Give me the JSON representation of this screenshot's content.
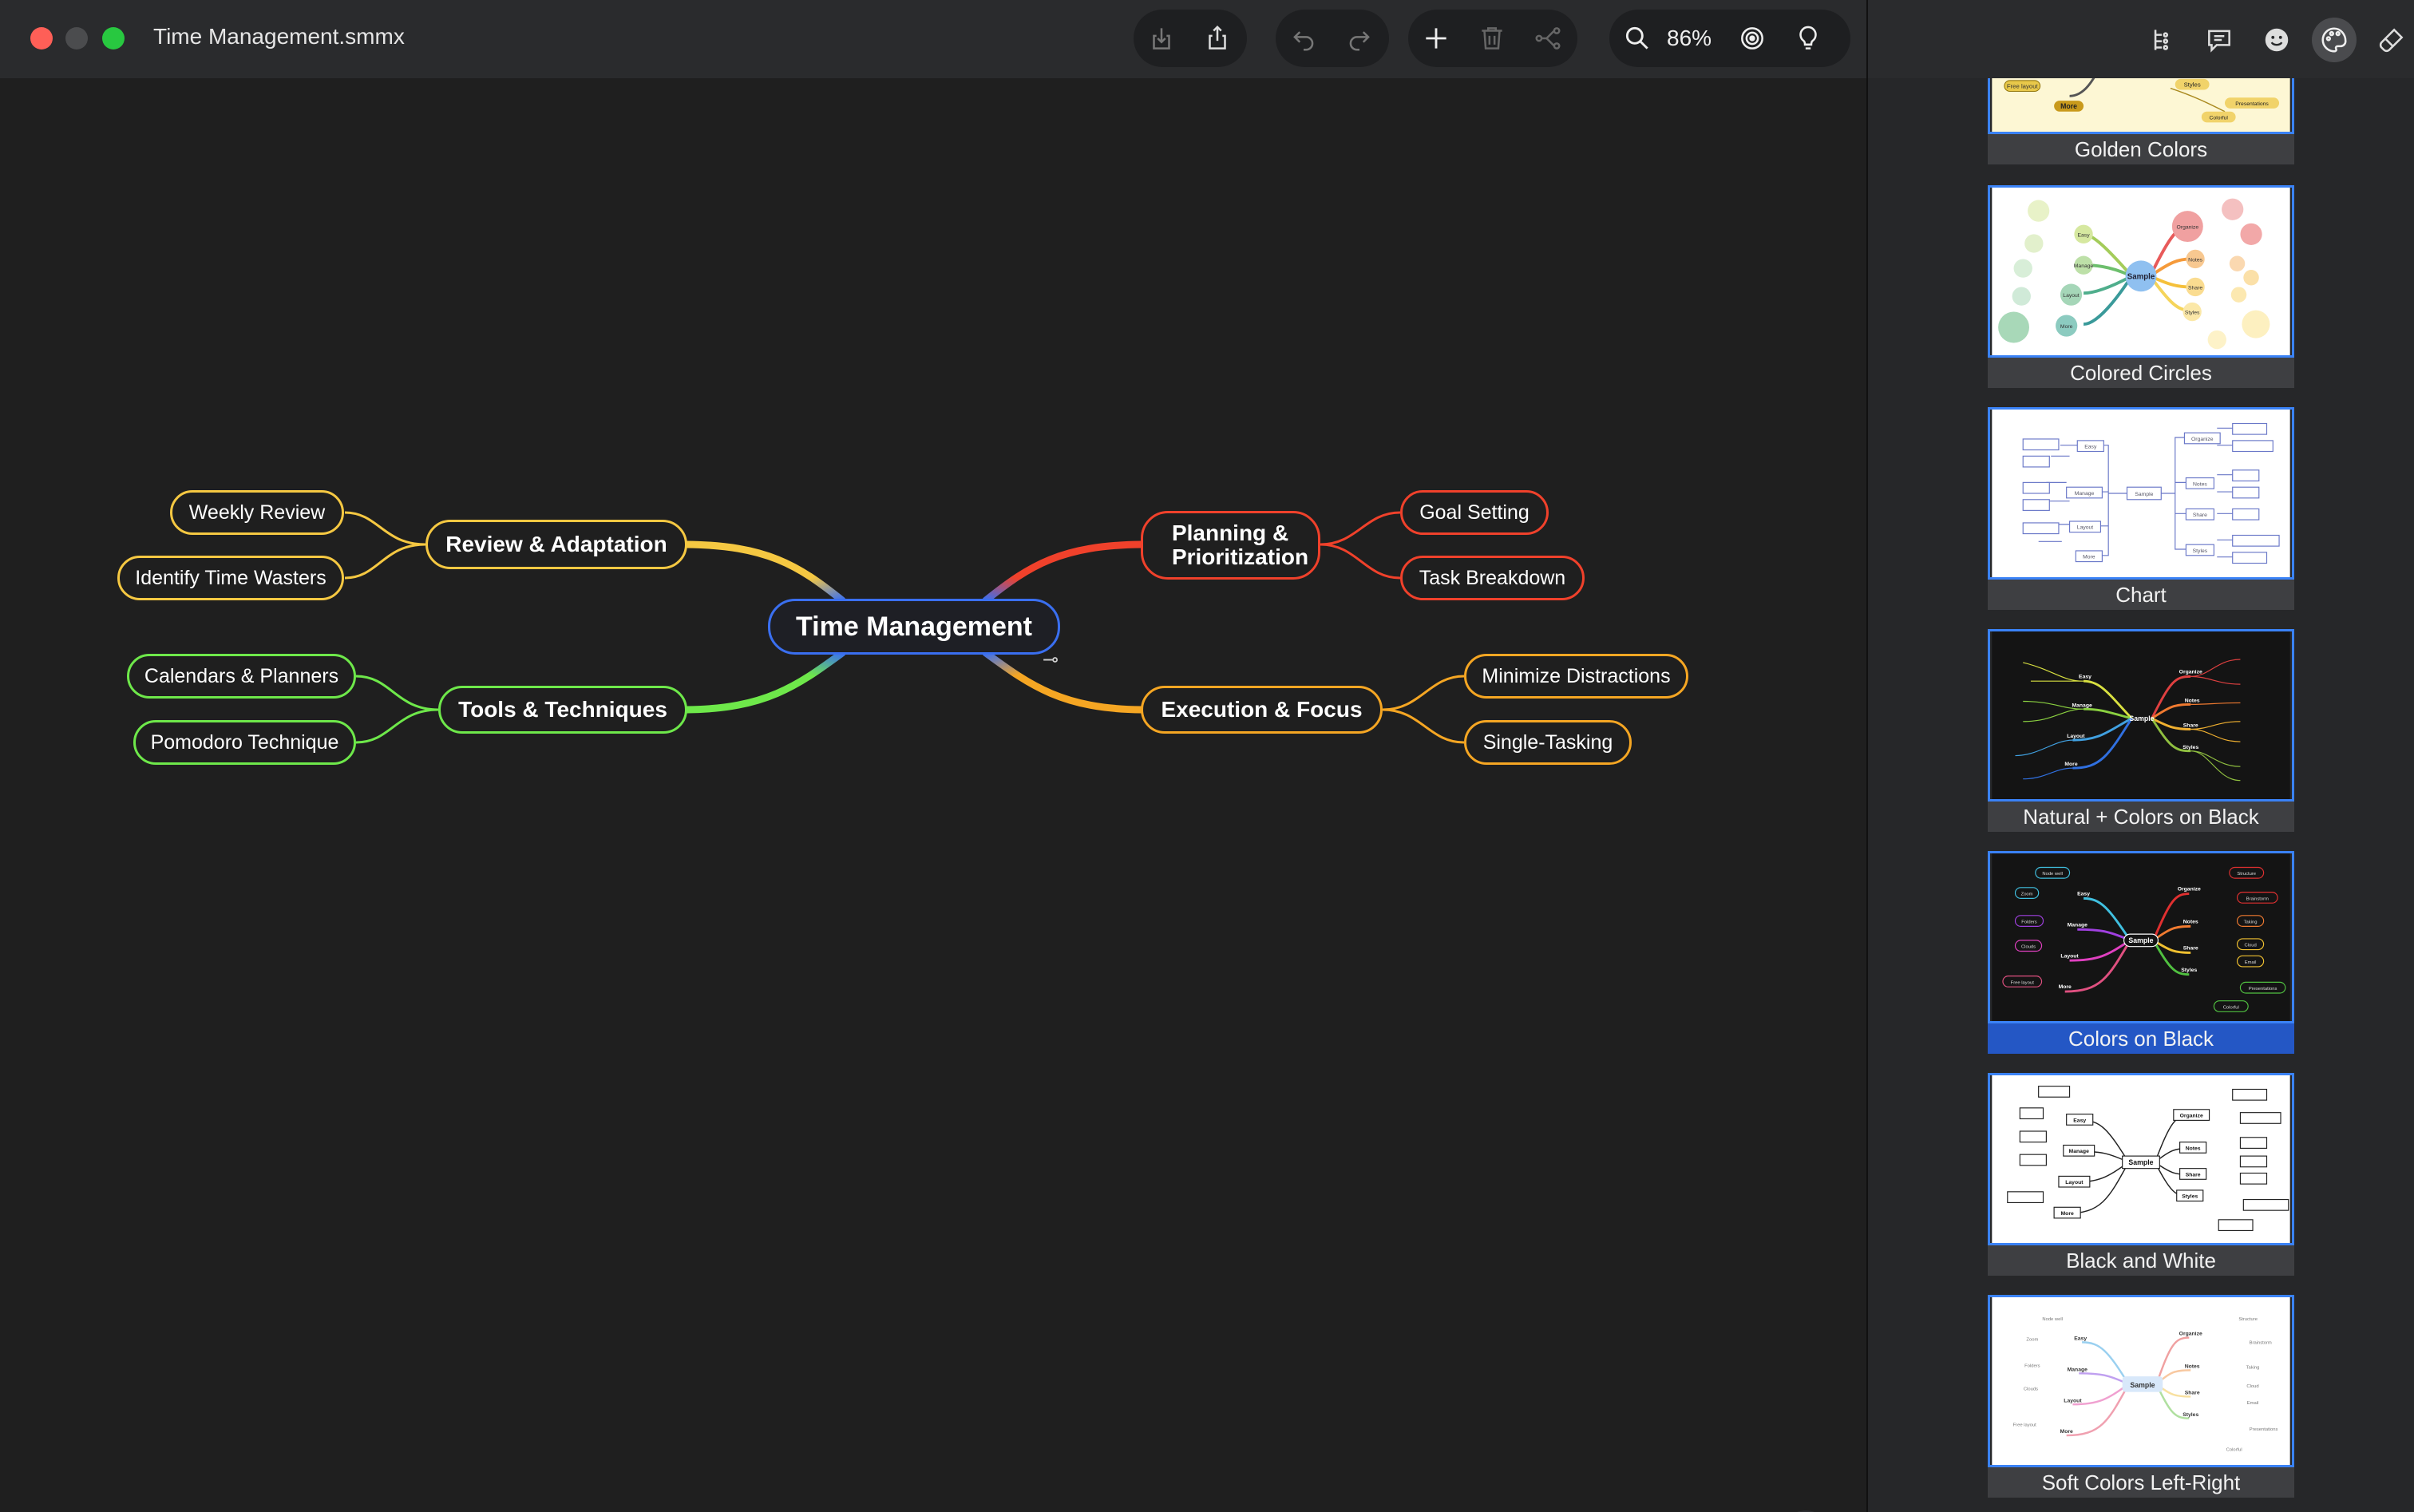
{
  "window": {
    "title": "Time Management.smmx",
    "zoom": "86%"
  },
  "toolbar": {
    "icons": [
      "export-icon",
      "share-icon",
      "undo-icon",
      "redo-icon",
      "add-icon",
      "trash-icon",
      "connect-icon",
      "search-icon",
      "focus-icon",
      "idea-icon"
    ]
  },
  "sidebar": {
    "tabs": [
      "outline-icon",
      "notes-icon",
      "emoji-icon",
      "palette-icon",
      "style-brush-icon"
    ],
    "active_tab": "palette-icon",
    "themes": [
      {
        "label": "Golden Colors",
        "selected": false
      },
      {
        "label": "Colored Circles",
        "selected": false
      },
      {
        "label": "Chart",
        "selected": false
      },
      {
        "label": "Natural + Colors on Black",
        "selected": false
      },
      {
        "label": "Colors on Black",
        "selected": true
      },
      {
        "label": "Black and White",
        "selected": false
      },
      {
        "label": "Soft Colors Left-Right",
        "selected": false
      }
    ],
    "thumb_words": {
      "sample": "Sample",
      "left": [
        "Easy",
        "Manage",
        "Layout",
        "More"
      ],
      "right": [
        "Organize",
        "Notes",
        "Share",
        "Styles"
      ],
      "left_leaves": [
        "Node well",
        "Zoom",
        "Folders",
        "Clouds",
        "Free layout"
      ],
      "right_leaves": [
        "Structure",
        "Brainstorm",
        "Taking",
        "Cloud",
        "Email",
        "Presentations",
        "Colorful"
      ]
    }
  },
  "mindmap": {
    "root": "Time Management",
    "branches": {
      "review": {
        "title": "Review & Adaptation",
        "color": "#f5c842",
        "children": [
          "Weekly Review",
          "Identify Time Wasters"
        ]
      },
      "tools": {
        "title": "Tools & Techniques",
        "color": "#6ee84a",
        "children": [
          "Calendars & Planners",
          "Pomodoro Technique"
        ]
      },
      "planning": {
        "title_line1": "Planning &",
        "title_line2": "Prioritization",
        "color": "#f0412b",
        "children": [
          "Goal Setting",
          "Task Breakdown"
        ]
      },
      "execution": {
        "title": "Execution & Focus",
        "color": "#f5a623",
        "children": [
          "Minimize Distractions",
          "Single-Tasking"
        ]
      }
    }
  }
}
